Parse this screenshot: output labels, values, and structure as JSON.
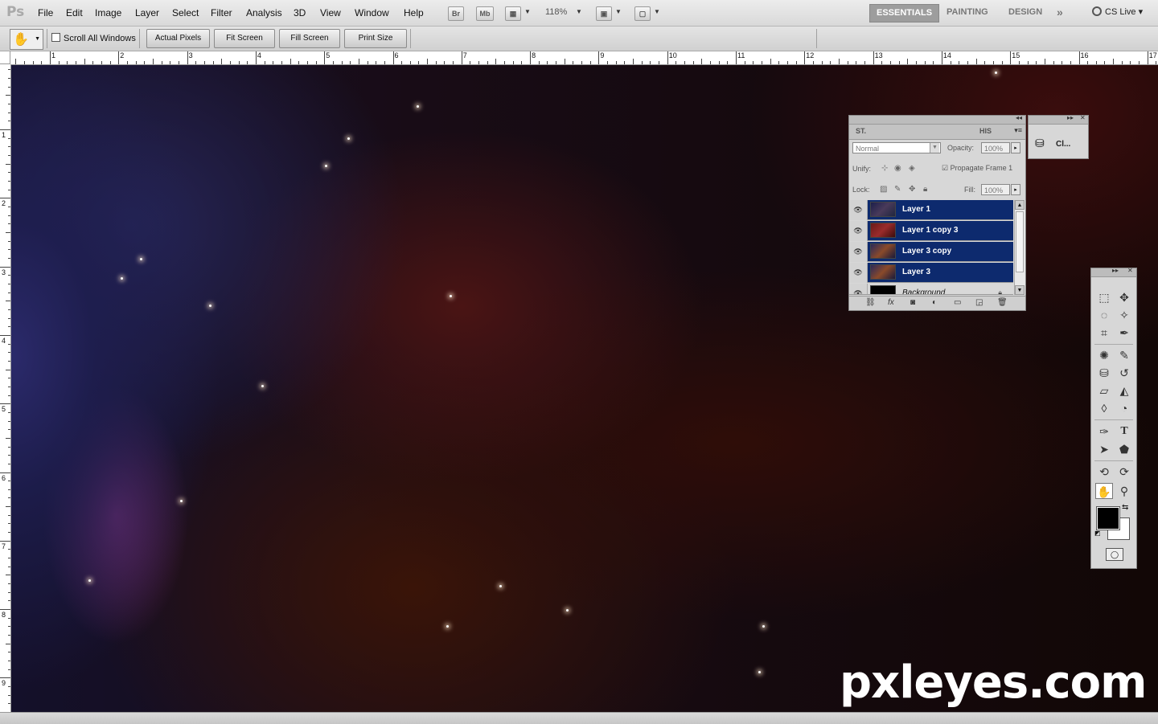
{
  "app": {
    "logo": "Ps",
    "menu": [
      "File",
      "Edit",
      "Image",
      "Layer",
      "Select",
      "Filter",
      "Analysis",
      "3D",
      "View",
      "Window",
      "Help"
    ],
    "bridge_button": "Br",
    "minibridge_button": "Mb",
    "zoom": "118%",
    "workspaces": [
      "ESSENTIALS",
      "PAINTING",
      "DESIGN"
    ],
    "active_workspace": "ESSENTIALS",
    "more_workspaces": "»",
    "cs_live": "CS Live"
  },
  "options": {
    "scroll_all_windows": "Scroll All Windows",
    "actual_pixels": "Actual Pixels",
    "fit_screen": "Fit Screen",
    "fill_screen": "Fill Screen",
    "print_size": "Print Size"
  },
  "rulers": {
    "horizontal": [
      "1",
      "2",
      "3",
      "4",
      "5",
      "6",
      "7",
      "8",
      "9",
      "10",
      "11",
      "12",
      "13",
      "14",
      "15",
      "16",
      "17"
    ],
    "vertical": [
      "1",
      "2",
      "3",
      "4",
      "5",
      "6",
      "7",
      "8",
      "9"
    ]
  },
  "layers_panel": {
    "tab_left": "ST.",
    "tab_right": "HIS",
    "blend_mode": "Normal",
    "opacity_label": "Opacity:",
    "opacity": "100%",
    "unify_label": "Unify:",
    "propagate_label": "Propagate Frame 1",
    "lock_label": "Lock:",
    "fill_label": "Fill:",
    "fill": "100%",
    "layers": [
      {
        "name": "Layer 1",
        "selected": true
      },
      {
        "name": "Layer 1 copy 3",
        "selected": true
      },
      {
        "name": "Layer 3 copy",
        "selected": true
      },
      {
        "name": "Layer 3",
        "selected": true
      },
      {
        "name": "Background",
        "selected": false
      }
    ]
  },
  "clone_panel": {
    "label": "Cl..."
  },
  "watermark": "pxleyes.com",
  "colors": {
    "selection": "#0d2a6e",
    "foreground": "#000000",
    "background": "#ffffff"
  }
}
